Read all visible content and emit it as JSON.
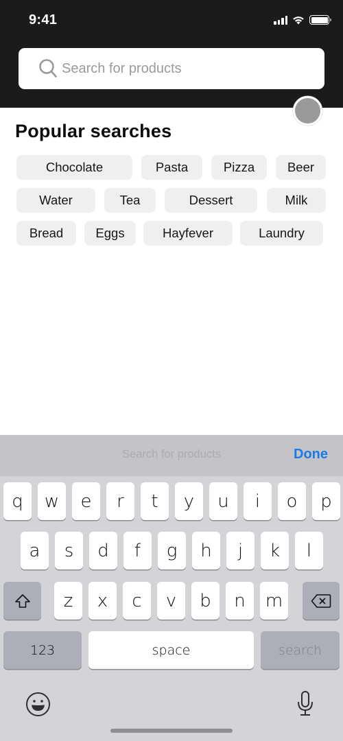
{
  "status_bar": {
    "time": "9:41",
    "icons": [
      "cellular-signal-icon",
      "wifi-icon",
      "battery-icon"
    ]
  },
  "search": {
    "placeholder": "Search for products",
    "value": "",
    "icon": "search-icon"
  },
  "popular": {
    "title": "Popular searches",
    "chips": [
      {
        "label": "Chocolate"
      },
      {
        "label": "Pasta"
      },
      {
        "label": "Pizza"
      },
      {
        "label": "Beer"
      },
      {
        "label": "Water"
      },
      {
        "label": "Tea"
      },
      {
        "label": "Dessert"
      },
      {
        "label": "Milk"
      },
      {
        "label": "Bread"
      },
      {
        "label": "Eggs"
      },
      {
        "label": "Hayfever"
      },
      {
        "label": "Laundry"
      }
    ]
  },
  "keyboard": {
    "accessory_placeholder": "Search for products",
    "done_label": "Done",
    "row1": [
      "q",
      "w",
      "e",
      "r",
      "t",
      "y",
      "u",
      "i",
      "o",
      "p"
    ],
    "row2": [
      "a",
      "s",
      "d",
      "f",
      "g",
      "h",
      "j",
      "k",
      "l"
    ],
    "row3": [
      "z",
      "x",
      "c",
      "v",
      "b",
      "n",
      "m"
    ],
    "numbers_label": "123",
    "space_label": "space",
    "return_label": "search",
    "icons": [
      "shift-icon",
      "delete-icon",
      "emoji-icon",
      "microphone-icon"
    ]
  },
  "colors": {
    "header_bg": "#1c1a1b",
    "chip_bg": "#efeff0",
    "done_blue": "#1c7ae6",
    "keyboard_bg": "#d3d3d8"
  }
}
